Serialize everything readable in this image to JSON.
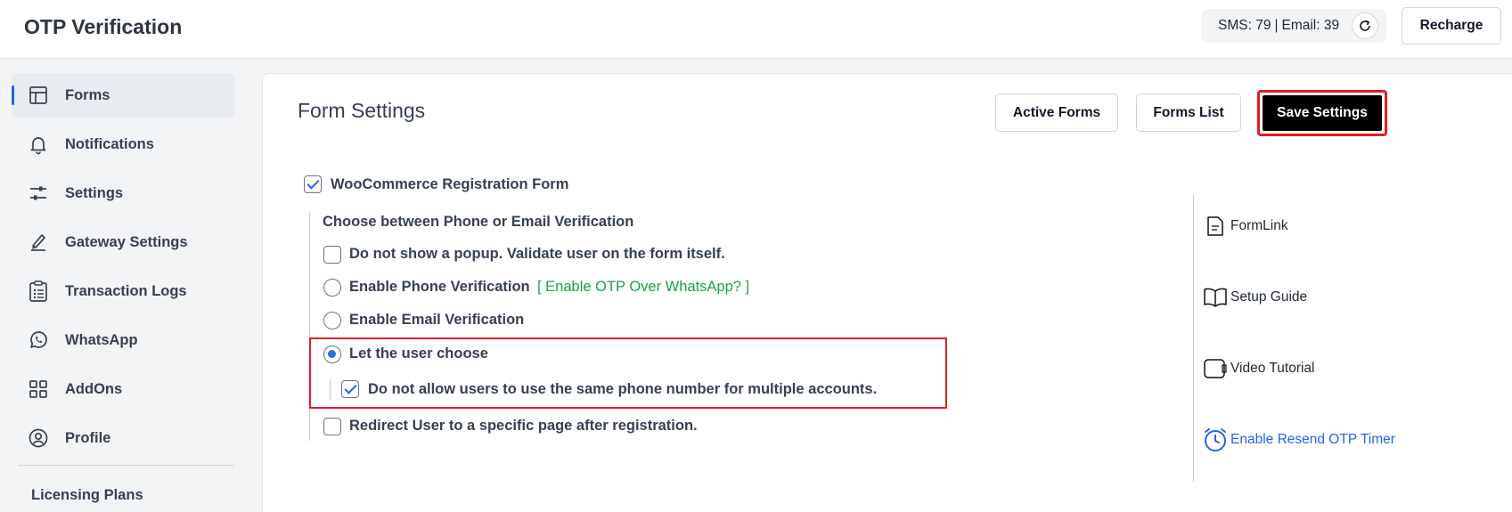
{
  "header": {
    "title": "OTP Verification",
    "sms_count": "SMS: 79",
    "separator": "|",
    "email_count": "Email: 39",
    "recharge_label": "Recharge"
  },
  "sidebar": {
    "items": [
      {
        "label": "Forms",
        "icon": "forms-icon",
        "active": true
      },
      {
        "label": "Notifications",
        "icon": "bell-icon"
      },
      {
        "label": "Settings",
        "icon": "sliders-icon"
      },
      {
        "label": "Gateway Settings",
        "icon": "pen-icon"
      },
      {
        "label": "Transaction Logs",
        "icon": "clipboard-list-icon"
      },
      {
        "label": "WhatsApp",
        "icon": "whatsapp-icon"
      },
      {
        "label": "AddOns",
        "icon": "grid-icon"
      },
      {
        "label": "Profile",
        "icon": "user-circle-icon"
      }
    ],
    "licensing_label": "Licensing Plans"
  },
  "main": {
    "title": "Form Settings",
    "active_forms_label": "Active Forms",
    "forms_list_label": "Forms List",
    "save_label": "Save Settings",
    "form_name": "WooCommerce Registration Form",
    "section_heading": "Choose between Phone or Email Verification",
    "options": {
      "no_popup": "Do not show a popup. Validate user on the form itself.",
      "phone": "Enable Phone Verification",
      "whatsapp_link": "[ Enable OTP Over WhatsApp? ]",
      "email": "Enable Email Verification",
      "user_choose": "Let the user choose",
      "same_phone": "Do not allow users to use the same phone number for multiple accounts.",
      "redirect": "Redirect User to a specific page after registration."
    }
  },
  "right_links": {
    "formlink": "FormLink",
    "setup_guide": "Setup Guide",
    "video_tutorial": "Video Tutorial",
    "resend_timer": "Enable Resend OTP Timer"
  },
  "colors": {
    "accent": "#2563eb",
    "highlight": "#e11d2a",
    "link_green": "#16a34a"
  }
}
